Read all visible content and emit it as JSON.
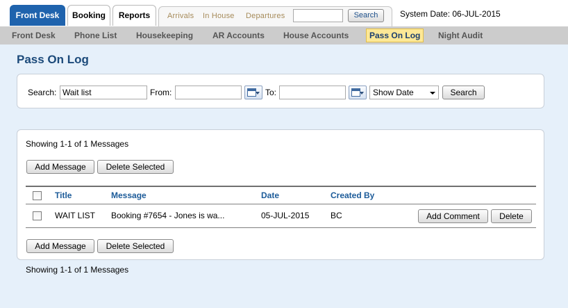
{
  "top_tabs": [
    {
      "label": "Front Desk",
      "active": true
    },
    {
      "label": "Booking",
      "active": false
    },
    {
      "label": "Reports",
      "active": false
    }
  ],
  "quick_links": [
    "Arrivals",
    "In House",
    "Departures"
  ],
  "quick_search": {
    "value": "",
    "button_label": "Search"
  },
  "system_date": "System Date: 06-JUL-2015",
  "subnav": [
    {
      "label": "Front Desk",
      "active": false
    },
    {
      "label": "Phone List",
      "active": false
    },
    {
      "label": "Housekeeping",
      "active": false
    },
    {
      "label": "AR Accounts",
      "active": false
    },
    {
      "label": "House Accounts",
      "active": false
    },
    {
      "label": "Pass On Log",
      "active": true
    },
    {
      "label": "Night Audit",
      "active": false
    }
  ],
  "page_title": "Pass On Log",
  "search_form": {
    "search_label": "Search:",
    "search_value": "Wait list",
    "from_label": "From:",
    "from_value": "",
    "to_label": "To:",
    "to_value": "",
    "date_select": "Show Date",
    "search_button": "Search"
  },
  "messages": {
    "showing_top": "Showing 1-1 of 1 Messages",
    "showing_bottom": "Showing 1-1 of 1 Messages",
    "add_message_label": "Add Message",
    "delete_selected_label": "Delete Selected",
    "columns": {
      "title": "Title",
      "message": "Message",
      "date": "Date",
      "created_by": "Created By"
    },
    "rows": [
      {
        "title": "WAIT LIST",
        "message": "Booking #7654 - Jones is wa...",
        "date": "05-JUL-2015",
        "created_by": "BC",
        "add_comment_label": "Add Comment",
        "delete_label": "Delete"
      }
    ]
  }
}
